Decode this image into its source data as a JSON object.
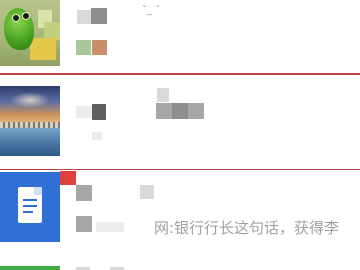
{
  "feed": {
    "items": [
      {
        "id_hint": "item-1",
        "meta_text": "ˇ_ ˇ",
        "thumbnail": "frog-image"
      },
      {
        "id_hint": "item-2",
        "thumbnail": "lake-bridge-landscape"
      },
      {
        "id_hint": "item-3",
        "thumbnail": "document-icon",
        "preview_text": "网:银行行长这句话，获得李"
      },
      {
        "id_hint": "item-4",
        "thumbnail": "green-strip"
      }
    ]
  },
  "colors": {
    "divider": "#b84545",
    "badge": "#e0403e",
    "doc_bg": "#2f6fd6"
  }
}
